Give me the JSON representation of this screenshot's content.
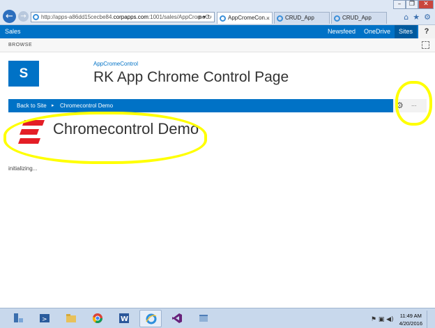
{
  "browser": {
    "address": {
      "prefix": "http://apps-a86dd15cecbe84.",
      "host": "corpapps.com",
      "suffix": ":1001/sales/AppCromeC",
      "tools": "ρ ▾ ↻"
    },
    "tabs": [
      {
        "label": "AppCromeCon...",
        "close": "×",
        "active": true
      },
      {
        "label": "CRUD_App",
        "active": false
      },
      {
        "label": "CRUD_App",
        "active": false
      }
    ],
    "window_controls": {
      "minimize": "–",
      "restore": "❐",
      "close": "✕"
    },
    "right_icons": {
      "home": "⌂",
      "favorites": "★",
      "tools": "⚙"
    }
  },
  "suite_bar": {
    "site_name": "Sales",
    "links": [
      "Newsfeed",
      "OneDrive",
      "Sites"
    ],
    "active_link": "Sites",
    "help": "?"
  },
  "ribbon": {
    "browse_tab": "BROWSE"
  },
  "site_header": {
    "logo_letter": "S",
    "app_link": "AppCromeControl",
    "page_title": "RK App Chrome Control Page"
  },
  "chrome_control": {
    "back_link": "Back to Site",
    "separator": "▸",
    "current": "Chromecontrol Demo",
    "settings_icon": "gear-icon",
    "more": "...",
    "title": "Chromecontrol Demo",
    "status": "initializing..."
  },
  "taskbar": {
    "apps": [
      "server-manager-icon",
      "powershell-icon",
      "explorer-icon",
      "chrome-icon",
      "word-icon",
      "internet-explorer-icon",
      "visual-studio-icon",
      "generic-app-icon"
    ],
    "active_app": "internet-explorer-icon",
    "tray_icons": "⚑ ▣ ◀)",
    "time": "11:49 AM",
    "date": "4/20/2016"
  },
  "colors": {
    "sharepoint_blue": "#0072c6",
    "highlight_yellow": "#ffff00",
    "chrome_logo_red": "#e41e26"
  }
}
